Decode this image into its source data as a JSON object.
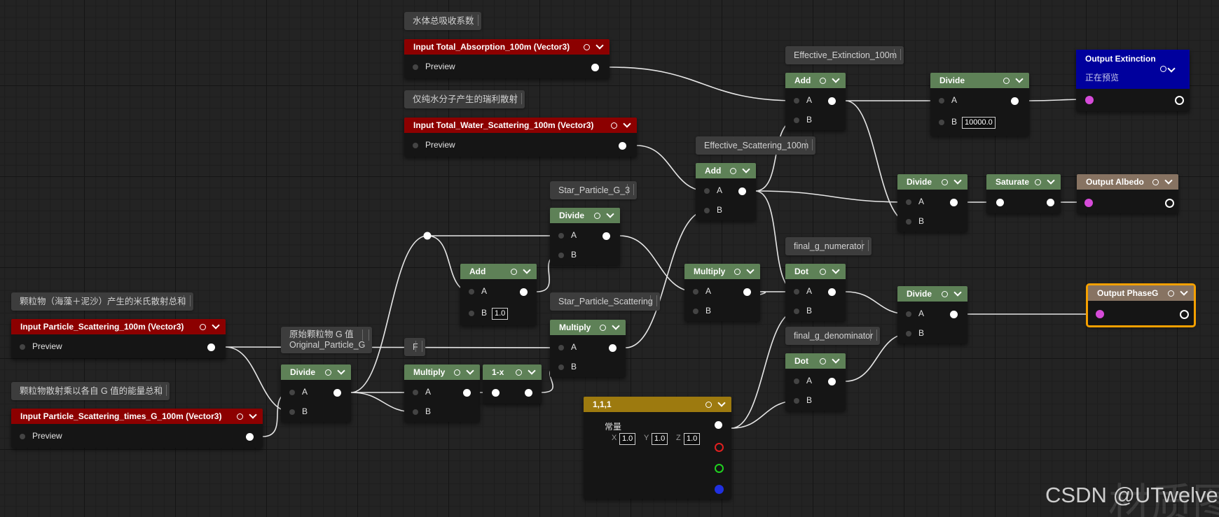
{
  "comments": {
    "absorption": "水体总吸收系数",
    "water_scattering": "仅纯水分子产生的瑞利散射",
    "particle_scattering": "颗粒物（海藻＋泥沙）产生的米氏散射总和",
    "particle_times_g": "颗粒物散射乘以各自 G 值的能量总和",
    "effective_extinction": "Effective_Extinction_100m",
    "effective_scattering": "Effective_Scattering_100m",
    "star_g3": "Star_Particle_G_3",
    "star_scattering": "Star_Particle_Scattering",
    "original_g_line1": "原始颗粒物 G 值",
    "original_g_line2": "Original_Particle_G",
    "final_num": "final_g_numerator",
    "final_den": "final_g_denominator",
    "f": "F"
  },
  "nodes": {
    "in_absorption": {
      "title": "Input Total_Absorption_100m (Vector3)",
      "pin": "Preview"
    },
    "in_water": {
      "title": "Input Total_Water_Scattering_100m (Vector3)",
      "pin": "Preview"
    },
    "in_particle": {
      "title": "Input Particle_Scattering_100m (Vector3)",
      "pin": "Preview"
    },
    "in_particle_g": {
      "title": "Input Particle_Scattering_times_G_100m (Vector3)",
      "pin": "Preview"
    },
    "add_ext": {
      "title": "Add",
      "a": "A",
      "b": "B"
    },
    "divide_ext": {
      "title": "Divide",
      "a": "A",
      "b": "B",
      "b_value": "10000.0"
    },
    "out_ext": {
      "title": "Output Extinction",
      "subtitle": "正在预览"
    },
    "add_sca": {
      "title": "Add",
      "a": "A",
      "b": "B"
    },
    "divide_alb": {
      "title": "Divide",
      "a": "A",
      "b": "B"
    },
    "saturate": {
      "title": "Saturate"
    },
    "out_alb": {
      "title": "Output Albedo"
    },
    "divide_g3": {
      "title": "Divide",
      "a": "A",
      "b": "B"
    },
    "add_small": {
      "title": "Add",
      "a": "A",
      "b": "B",
      "b_value": "1.0"
    },
    "multiply_star": {
      "title": "Multiply",
      "a": "A",
      "b": "B"
    },
    "multiply_mid": {
      "title": "Multiply",
      "a": "A",
      "b": "B"
    },
    "dot_num": {
      "title": "Dot",
      "a": "A",
      "b": "B"
    },
    "dot_den": {
      "title": "Dot",
      "a": "A",
      "b": "B"
    },
    "divide_g": {
      "title": "Divide",
      "a": "A",
      "b": "B"
    },
    "out_phase": {
      "title": "Output PhaseG"
    },
    "divide_orig": {
      "title": "Divide",
      "a": "A",
      "b": "B"
    },
    "multiply_left": {
      "title": "Multiply",
      "a": "A",
      "b": "B"
    },
    "one_minus": {
      "title": "1-x"
    },
    "constant": {
      "title": "1,1,1",
      "label": "常量",
      "x_label": "X",
      "x": "1.0",
      "y_label": "Y",
      "y": "1.0",
      "z_label": "Z",
      "z": "1.0"
    }
  },
  "watermark": {
    "text": "CSDN @UTwelve",
    "faint": "材质图"
  },
  "colors": {
    "input_red": "#8c0000",
    "math_green": "#5e8157",
    "output_brown": "#877362",
    "output_blue": "#00009d",
    "constant_gold": "#9d7a0f",
    "selection": "#f5a000"
  }
}
